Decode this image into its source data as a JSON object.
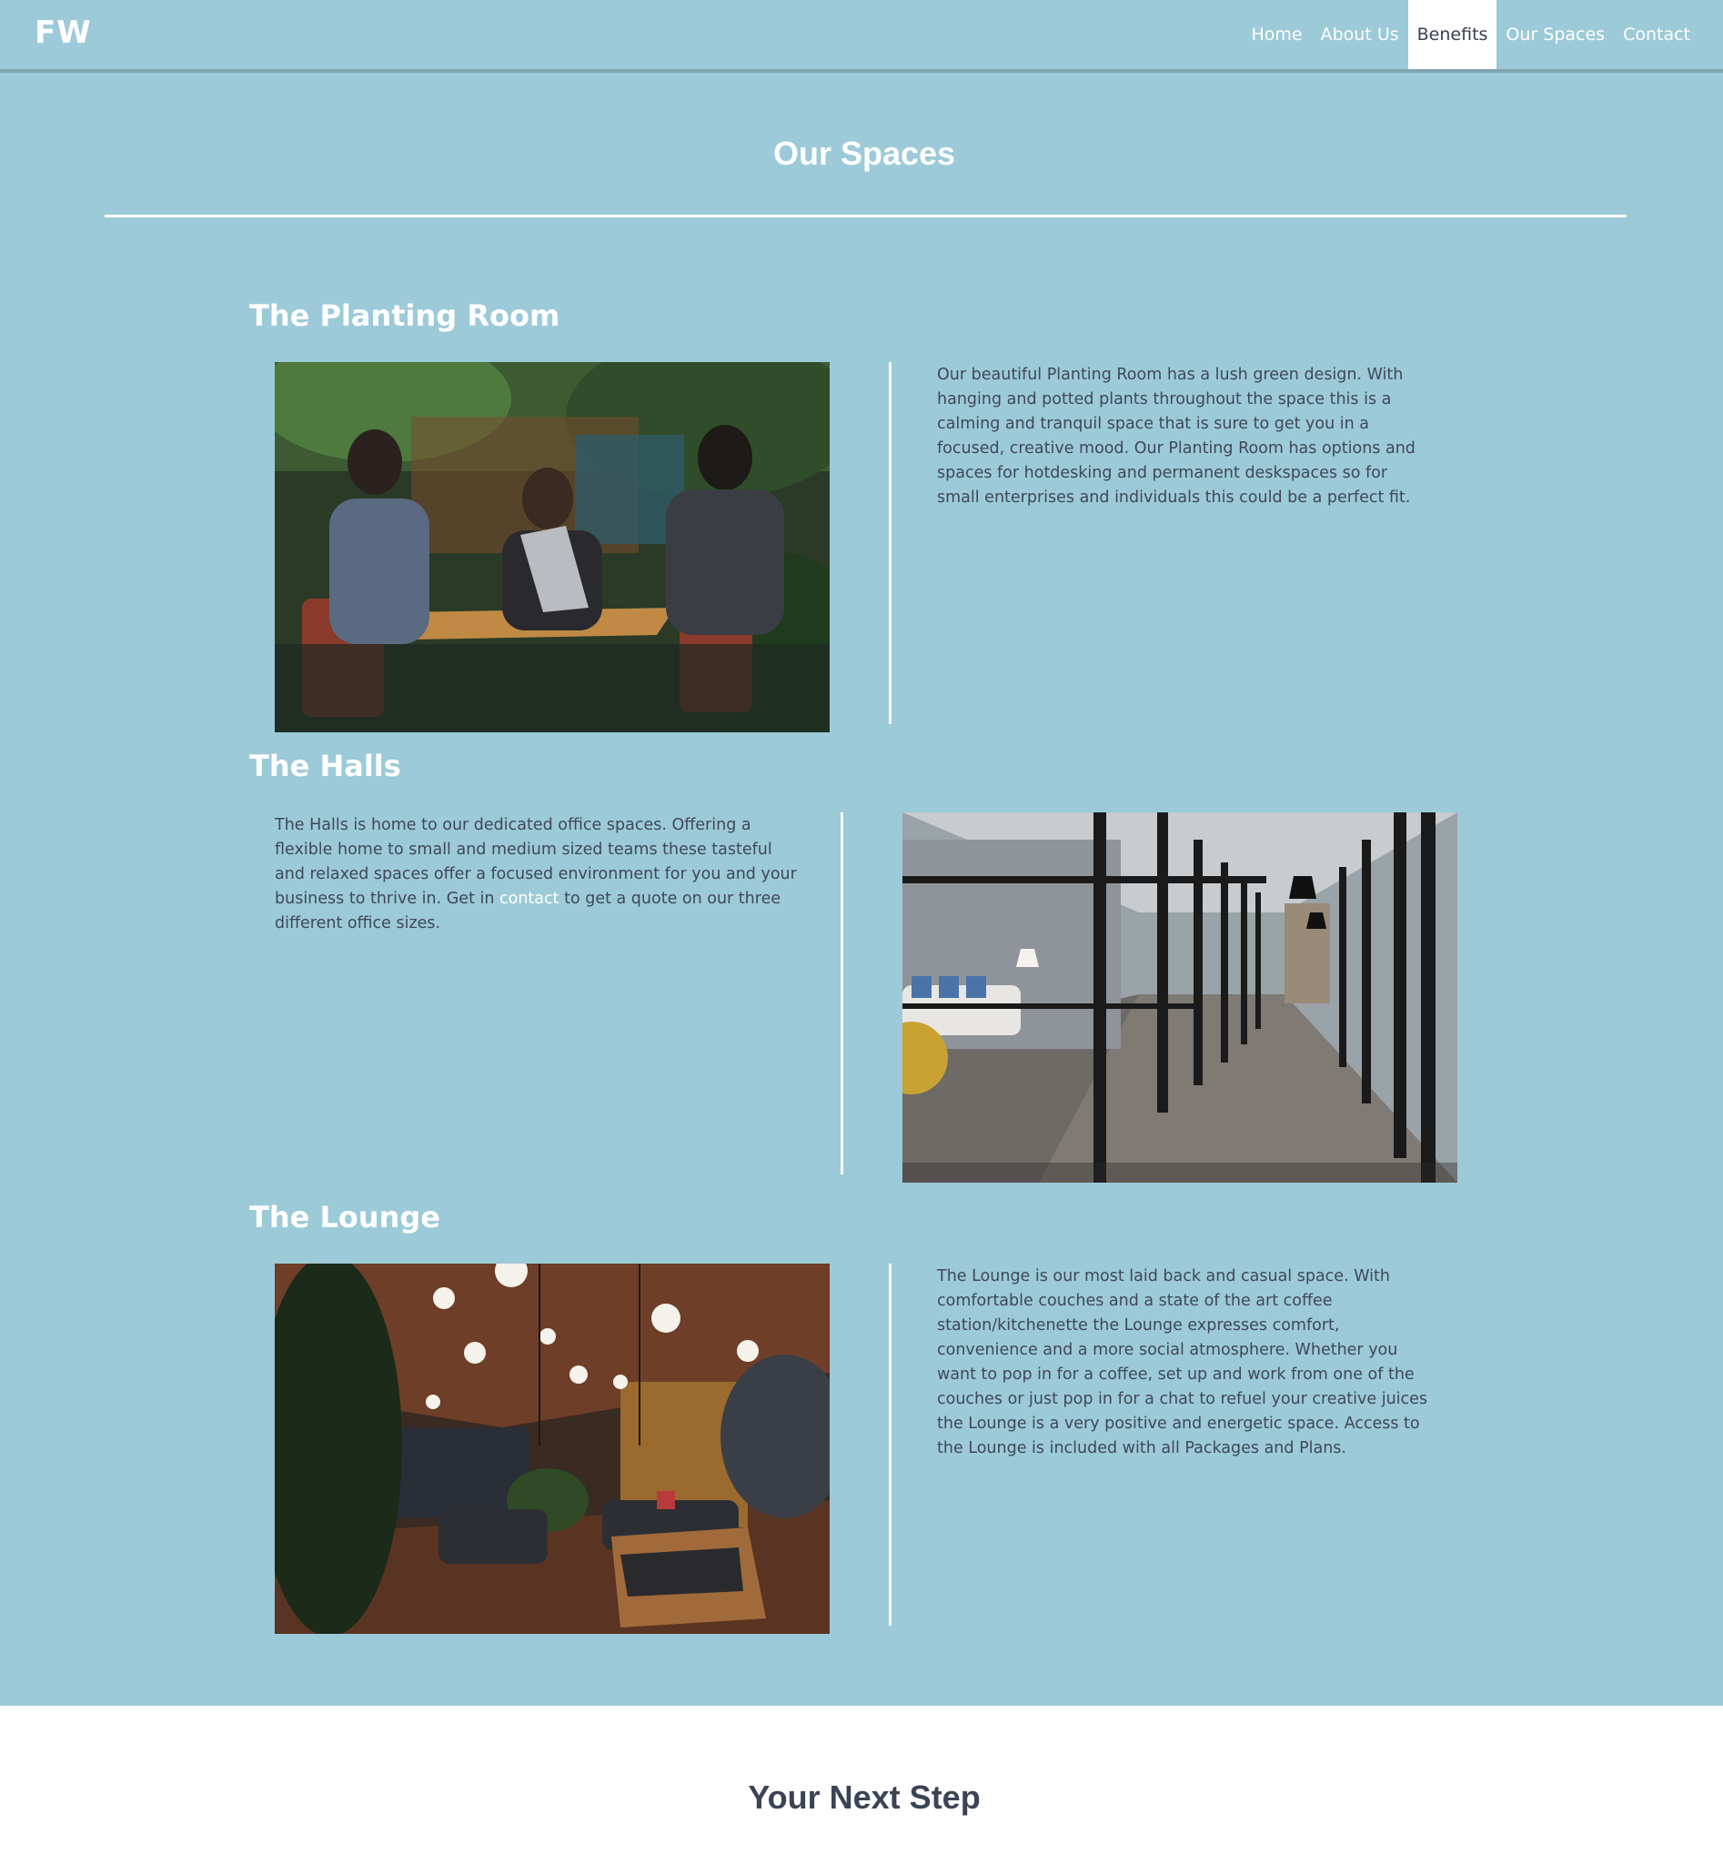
{
  "header": {
    "logo": "FW",
    "nav": [
      {
        "label": "Home",
        "active": false
      },
      {
        "label": "About Us",
        "active": false
      },
      {
        "label": "Benefits",
        "active": true
      },
      {
        "label": "Our Spaces",
        "active": false
      },
      {
        "label": "Contact",
        "active": false
      }
    ]
  },
  "spaces": {
    "title": "Our Spaces",
    "items": [
      {
        "heading": "The Planting Room",
        "description": "Our beautiful Planting Room has a lush green design. With hanging and potted plants throughout the space this is a calming and tranquil space that is sure to get you in a focused, creative mood. Our Planting Room has options and spaces for hotdesking and permanent deskspaces so for small enterprises and individuals this could be a perfect fit."
      },
      {
        "heading": "The Halls",
        "description_before": "The Halls is home to our dedicated office spaces. Offering a flexible home to small and medium sized teams these tasteful and relaxed spaces offer a focused environment for you and your business to thrive in. Get in ",
        "link_text": "contact",
        "description_after": " to get a quote on our three different office sizes."
      },
      {
        "heading": "The Lounge",
        "description": "The Lounge is our most laid back and casual space. With comfortable couches and a state of the art coffee station/kitchenette the Lounge expresses comfort, convenience and a more social atmosphere. Whether you want to pop in for a coffee, set up and work from one of the couches or just pop in for a chat to refuel your creative juices the Lounge is a very positive and energetic space. Access to the Lounge is included with all Packages and Plans."
      }
    ]
  },
  "next_step": {
    "title": "Your Next Step"
  },
  "colors": {
    "section_bg": "#9ccad8",
    "text_dark": "#3f4858",
    "white": "#ffffff"
  }
}
